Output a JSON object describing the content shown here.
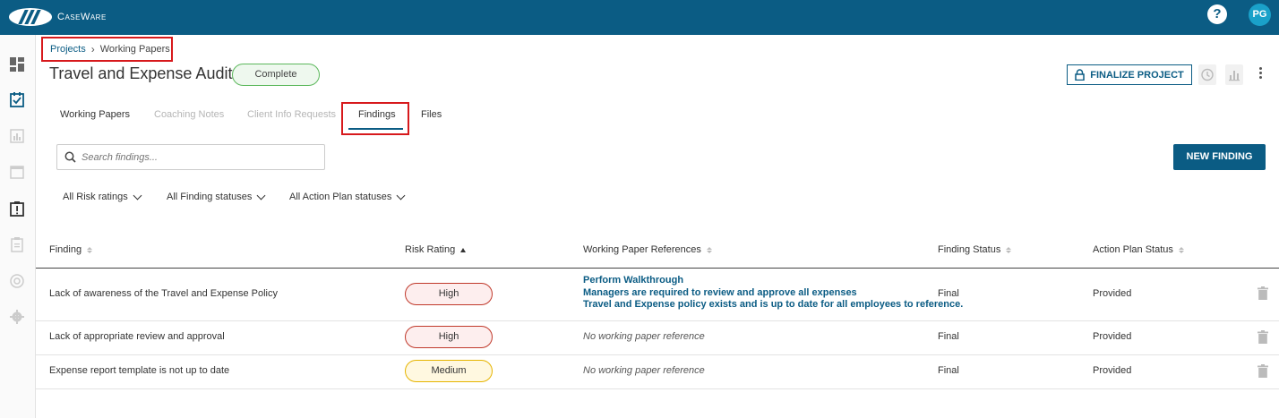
{
  "app": {
    "brand": "CaseWare",
    "help_label": "?",
    "user_initials": "PG"
  },
  "breadcrumb": {
    "parent": "Projects",
    "current": "Working Papers"
  },
  "project": {
    "title": "Travel and Expense Audit",
    "status": "Complete",
    "finalize_label": "FINALIZE PROJECT"
  },
  "tabs": [
    {
      "label": "Working Papers",
      "enabled": true
    },
    {
      "label": "Coaching Notes",
      "enabled": false
    },
    {
      "label": "Client Info Requests",
      "enabled": false
    },
    {
      "label": "Findings",
      "enabled": true,
      "active": true
    },
    {
      "label": "Files",
      "enabled": true
    }
  ],
  "search": {
    "placeholder": "Search findings..."
  },
  "new_finding_label": "NEW FINDING",
  "filters": [
    "All Risk ratings",
    "All Finding statuses",
    "All Action Plan statuses"
  ],
  "table": {
    "columns": [
      "Finding",
      "Risk Rating",
      "Working Paper References",
      "Finding Status",
      "Action Plan Status"
    ],
    "rows": [
      {
        "finding": "Lack of awareness of the Travel and Expense Policy",
        "risk": "High",
        "refs": [
          "Perform Walkthrough",
          "Managers are required to review and approve all expenses",
          "Travel and Expense policy exists and is up to date for all employees to reference."
        ],
        "finding_status": "Final",
        "action_plan_status": "Provided"
      },
      {
        "finding": "Lack of appropriate review and approval",
        "risk": "High",
        "no_ref": "No working paper reference",
        "finding_status": "Final",
        "action_plan_status": "Provided"
      },
      {
        "finding": "Expense report template is not up to date",
        "risk": "Medium",
        "no_ref": "No working paper reference",
        "finding_status": "Final",
        "action_plan_status": "Provided"
      }
    ]
  },
  "colors": {
    "topbar": "#0b5c84",
    "accent": "#0b5c84",
    "highlight_box": "#d7191c",
    "complete": "#5cb85c",
    "high": "#c0392b",
    "medium": "#e6b400"
  }
}
